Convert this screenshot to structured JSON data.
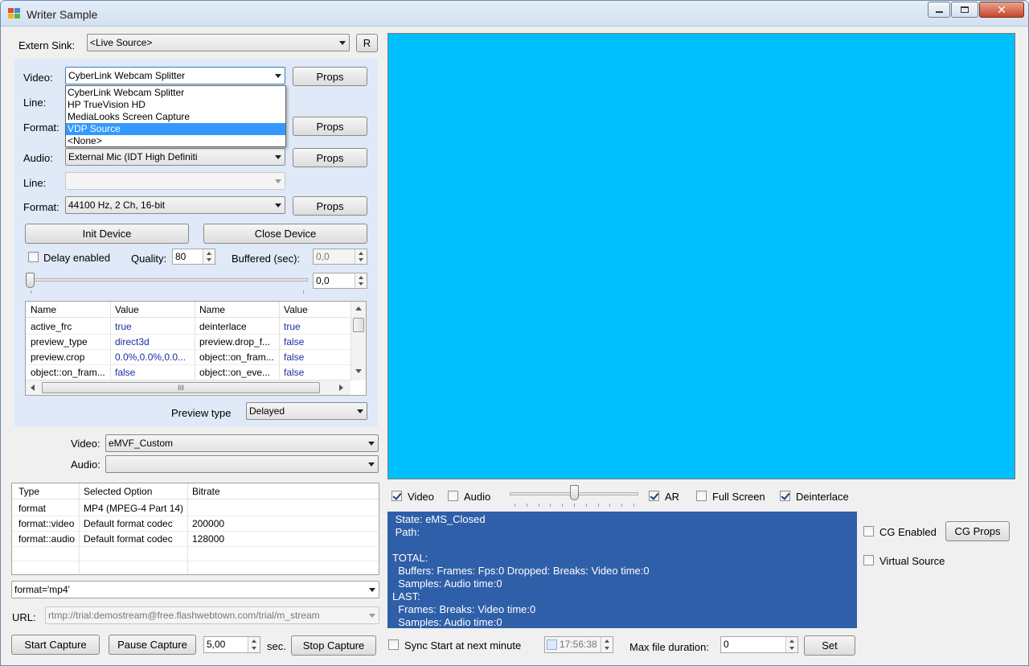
{
  "window": {
    "title": "Writer Sample"
  },
  "source": {
    "extern_sink_label": "Extern Sink:",
    "extern_sink_value": "<Live Source>",
    "r_button": "R",
    "video_label": "Video:",
    "video_value": "CyberLink Webcam Splitter",
    "video_options": [
      "CyberLink Webcam Splitter",
      "HP TrueVision HD",
      "MediaLooks Screen Capture",
      "VDP Source",
      "<None>"
    ],
    "video_selected_option": "VDP Source",
    "line_label": "Line:",
    "format_label": "Format:",
    "props_label": "Props",
    "audio_label": "Audio:",
    "audio_value": "External Mic (IDT High Definiti",
    "audio_line_label": "Line:",
    "audio_line_value": "",
    "audio_format_label": "Format:",
    "audio_format_value": "44100 Hz, 2 Ch, 16-bit",
    "init_device": "Init Device",
    "close_device": "Close Device",
    "delay_enabled_label": "Delay enabled",
    "delay_enabled": false,
    "quality_label": "Quality:",
    "quality_value": "80",
    "buffered_label": "Buffered (sec):",
    "buffered_value": "0,0",
    "delay_value": "0,0",
    "delay_slider_level": 0,
    "props_grid": {
      "headers": [
        "Name",
        "Value",
        "Name",
        "Value"
      ],
      "rows": [
        [
          "active_frc",
          "true",
          "deinterlace",
          "true"
        ],
        [
          "preview_type",
          "direct3d",
          "preview.drop_f...",
          "false"
        ],
        [
          "preview.crop",
          "0.0%,0.0%,0.0...",
          "object::on_fram...",
          "false"
        ],
        [
          "object::on_fram...",
          "false",
          "object::on_eve...",
          "false"
        ]
      ],
      "hscroll_glyph": "III"
    },
    "preview_type_label": "Preview type",
    "preview_type_value": "Delayed"
  },
  "encoder": {
    "video_label": "Video:",
    "video_value": "eMVF_Custom",
    "audio_label": "Audio:",
    "audio_value": "",
    "table": {
      "headers": [
        "Type",
        "Selected Option",
        "Bitrate"
      ],
      "rows": [
        [
          "format",
          "MP4 (MPEG-4 Part 14)",
          ""
        ],
        [
          "format::video",
          "Default format codec",
          "200000"
        ],
        [
          "format::audio",
          "Default format codec",
          "128000"
        ]
      ]
    },
    "format_string": "format='mp4'",
    "url_label": "URL:",
    "url_value": "rtmp://trial:demostream@free.flashwebtown.com/trial/m_stream"
  },
  "capture": {
    "start_capture": "Start Capture",
    "pause_capture": "Pause Capture",
    "seconds_value": "5,00",
    "sec_label": "sec.",
    "stop_capture": "Stop Capture",
    "sync_start_label": "Sync Start at next minute",
    "sync_start": false,
    "time_value": "17:56:38",
    "max_duration_label": "Max file duration:",
    "max_duration_value": "0",
    "set_button": "Set"
  },
  "preview_controls": {
    "video_label": "Video",
    "video_checked": true,
    "audio_label": "Audio",
    "audio_checked": false,
    "ar_label": "AR",
    "ar_checked": true,
    "fullscreen_label": "Full Screen",
    "fullscreen_checked": false,
    "deinterlace_label": "Deinterlace",
    "deinterlace_checked": true,
    "volume_level": 0.5
  },
  "status": {
    "lines": [
      " State: eMS_Closed",
      " Path:",
      "",
      "TOTAL:",
      "  Buffers: Frames: Fps:0 Dropped: Breaks: Video time:0",
      "  Samples: Audio time:0",
      "LAST:",
      "  Frames: Breaks: Video time:0",
      "  Samples: Audio time:0"
    ]
  },
  "cg": {
    "cg_enabled_label": "CG Enabled",
    "cg_enabled": false,
    "cg_props": "CG Props",
    "virtual_source_label": "Virtual Source",
    "virtual_source": false
  },
  "colors": {
    "preview_bg": "#00BFFF",
    "status_bg": "#2F5FA8",
    "panel_bg": "#DFE9F7",
    "selection": "#3399FF",
    "value_text": "#1A2FA0"
  },
  "icons": [
    "app-icon",
    "minimize-icon",
    "maximize-icon",
    "close-icon",
    "chevron-down-icon",
    "spin-up-icon",
    "spin-down-icon",
    "checkmark-icon"
  ]
}
